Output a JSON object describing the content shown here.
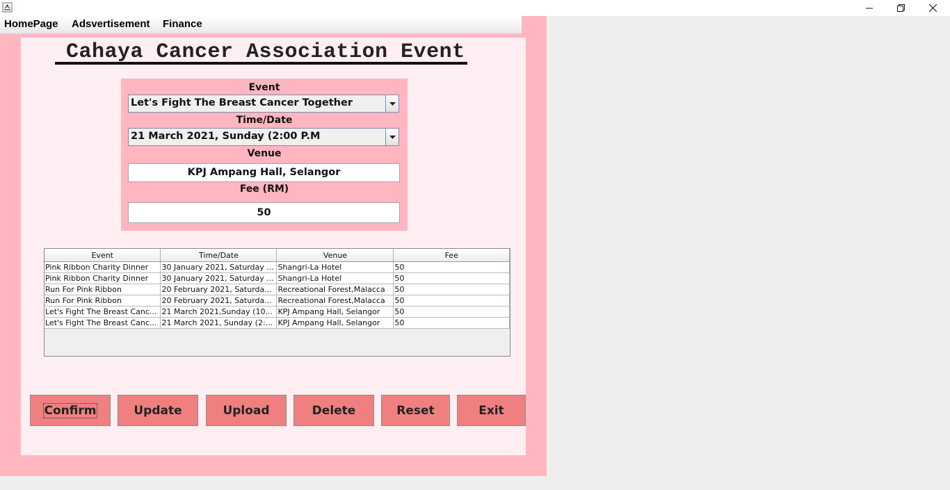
{
  "window": {
    "minimize_icon": "minimize-icon",
    "maximize_icon": "restore-icon",
    "close_icon": "close-icon"
  },
  "menu": {
    "items": [
      "HomePage",
      "Adsvertisement",
      "Finance"
    ]
  },
  "page": {
    "title": "Cahaya Cancer Association Event"
  },
  "form": {
    "event_label": "Event",
    "event_value": "Let's Fight The Breast Cancer Together",
    "time_label": "Time/Date",
    "time_value": "21 March 2021, Sunday (2:00 P.M",
    "venue_label": "Venue",
    "venue_value": "KPJ Ampang Hall, Selangor",
    "fee_label": "Fee (RM)",
    "fee_value": "50"
  },
  "table": {
    "columns": [
      "Event",
      "Time/Date",
      "Venue",
      "Fee"
    ],
    "rows": [
      [
        "Pink Ribbon Charity Dinner",
        "30 January 2021, Saturday ...",
        "Shangri-La Hotel",
        "50"
      ],
      [
        "Pink Ribbon Charity Dinner",
        "30 January 2021, Saturday ...",
        "Shangri-La Hotel",
        "50"
      ],
      [
        "Run For Pink Ribbon",
        "20 February 2021, Saturda...",
        "Recreational Forest,Malacca",
        "50"
      ],
      [
        "Run For Pink Ribbon",
        "20 February 2021, Saturda...",
        "Recreational Forest,Malacca",
        "50"
      ],
      [
        "Let's Fight The Breast Canc...",
        "21 March 2021,Sunday (10...",
        "KPJ Ampang Hall, Selangor",
        "50"
      ],
      [
        "Let's Fight The Breast Canc...",
        "21 March 2021, Sunday (2:...",
        "KPJ Ampang Hall, Selangor",
        "50"
      ]
    ]
  },
  "buttons": {
    "confirm": "Confirm",
    "update": "Update",
    "upload": "Upload",
    "delete": "Delete",
    "reset": "Reset",
    "exit": "Exit"
  },
  "colors": {
    "frame_background": "#ffb6c1",
    "panel_background": "#ffeef2",
    "button_background": "#f08080"
  }
}
